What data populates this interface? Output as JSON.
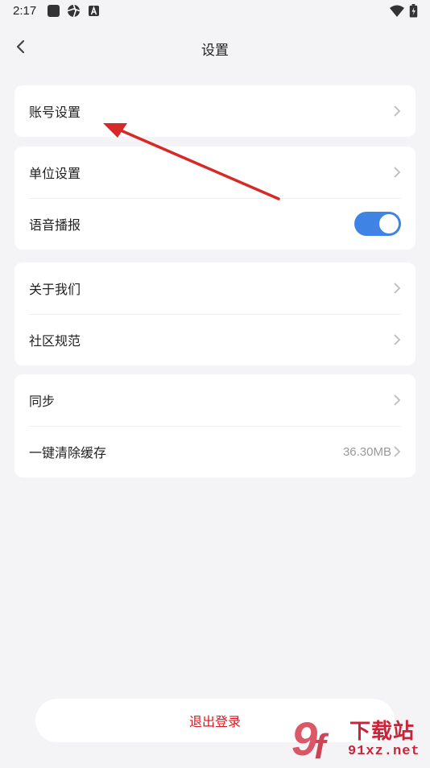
{
  "status_bar": {
    "time": "2:17",
    "left_icons": [
      "square-app-icon",
      "aperture-icon",
      "font-a-icon"
    ],
    "right_icons": [
      "wifi-icon",
      "battery-icon"
    ]
  },
  "header": {
    "title": "设置",
    "back_icon": "chevron-left-icon"
  },
  "groups": [
    {
      "items": [
        {
          "label": "账号设置",
          "control": "chevron"
        }
      ]
    },
    {
      "items": [
        {
          "label": "单位设置",
          "control": "chevron"
        },
        {
          "label": "语音播报",
          "control": "toggle",
          "toggle_on": true
        }
      ]
    },
    {
      "items": [
        {
          "label": "关于我们",
          "control": "chevron"
        },
        {
          "label": "社区规范",
          "control": "chevron"
        }
      ]
    },
    {
      "items": [
        {
          "label": "同步",
          "control": "chevron"
        },
        {
          "label": "一键清除缓存",
          "control": "chevron",
          "value": "36.30MB"
        }
      ]
    }
  ],
  "logout": {
    "label": "退出登录"
  },
  "watermark": {
    "logo_text": "9f",
    "brand_text": "下载站",
    "site_text": "91xz.net"
  },
  "colors": {
    "accent": "#3f84e5",
    "danger": "#e0141e",
    "annotation_arrow": "#d62a2a",
    "background": "#f4f4f6"
  }
}
